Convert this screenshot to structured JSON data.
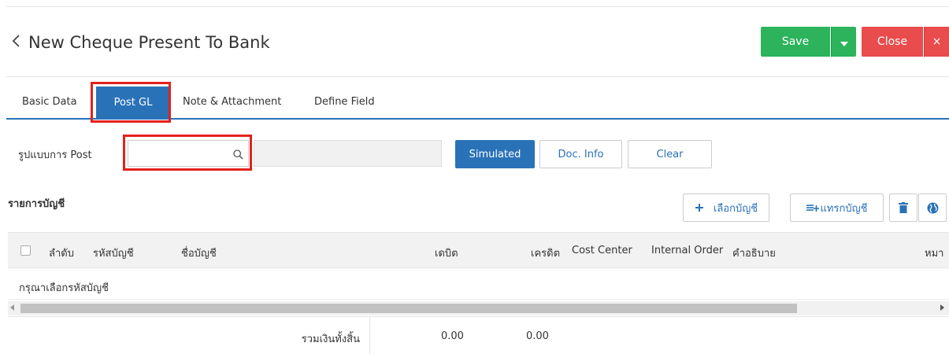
{
  "header": {
    "title": "New Cheque Present To Bank",
    "save_label": "Save",
    "close_label": "Close",
    "close_x": "×"
  },
  "tabs": [
    {
      "label": "Basic Data"
    },
    {
      "label": "Post GL"
    },
    {
      "label": "Note & Attachment"
    },
    {
      "label": "Define Field"
    }
  ],
  "post_form": {
    "label": "รูปแบบการ Post",
    "input_value": "",
    "display_value": "",
    "simulated_label": "Simulated",
    "doc_info_label": "Doc. Info",
    "clear_label": "Clear"
  },
  "section": {
    "title": "รายการบัญชี"
  },
  "toolbar": {
    "select_account_label": "เลือกบัญชี",
    "insert_account_label": "แทรกบัญชี"
  },
  "table": {
    "columns": [
      "ลำดับ",
      "รหัสบัญชี",
      "ชื่อบัญชี",
      "เดบิต",
      "เครดิต",
      "Cost Center",
      "Internal Order",
      "คำอธิบาย",
      "หมา"
    ],
    "empty_text": "กรุณาเลือกรหัสบัญชี",
    "footer": {
      "label": "รวมเงินทั้งสิ้น",
      "debit_total": "0.00",
      "credit_total": "0.00"
    }
  },
  "colors": {
    "primary": "#2a72b8",
    "save": "#2db35b",
    "close": "#e84c4c",
    "highlight": "#e3211d"
  },
  "icons": [
    "chevron-left-icon",
    "caret-down-icon",
    "search-icon",
    "plus-icon",
    "insert-rows-icon",
    "trash-icon",
    "globe-icon"
  ]
}
